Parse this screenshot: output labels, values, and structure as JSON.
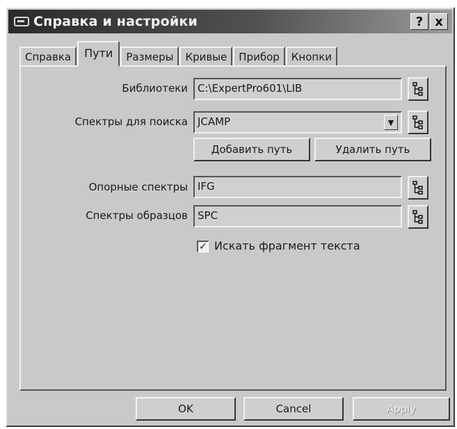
{
  "window": {
    "title": "Справка и настройки",
    "help_button": "?",
    "close_button": "x"
  },
  "tabs": [
    {
      "label": "Справка",
      "active": false
    },
    {
      "label": "Пути",
      "active": true
    },
    {
      "label": "Размеры",
      "active": false
    },
    {
      "label": "Кривые",
      "active": false
    },
    {
      "label": "Прибор",
      "active": false
    },
    {
      "label": "Кнопки",
      "active": false
    }
  ],
  "paths": {
    "libraries": {
      "label": "Библиотеки",
      "value": "C:\\ExpertPro601\\LIB"
    },
    "search_spectra": {
      "label": "Спектры для поиска",
      "value": "JCAMP"
    },
    "add_path_label": "Добавить путь",
    "remove_path_label": "Удалить путь",
    "reference_spectra": {
      "label": "Опорные спектры",
      "value": "IFG"
    },
    "sample_spectra": {
      "label": "Спектры образцов",
      "value": "SPC"
    },
    "search_fragment": {
      "label": "Искать фрагмент текста",
      "checked": true
    }
  },
  "footer": {
    "ok_label": "OK",
    "cancel_label": "Cancel",
    "apply_label": "Apply"
  }
}
